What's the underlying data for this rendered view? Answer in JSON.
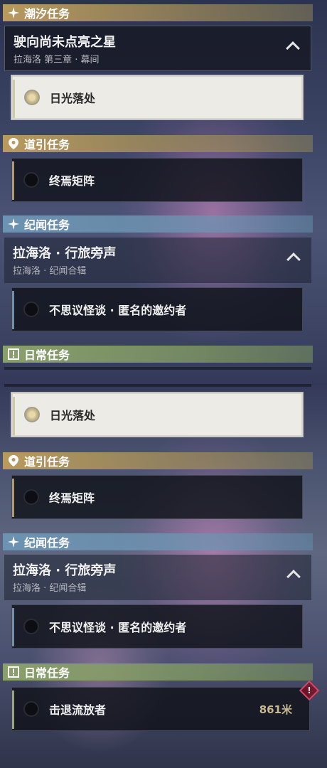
{
  "panels": [
    {
      "tide_header": "潮汐任务",
      "chapter_title": "驶向尚未点亮之星",
      "chapter_sub": "拉海洛 第三章 · 幕间",
      "tide_quest": "日光落处",
      "guide_header": "道引任务",
      "guide_quest": "终焉矩阵",
      "lore_header": "纪闻任务",
      "lore_title": "拉海洛 · 行旅旁声",
      "lore_sub": "拉海洛 · 纪闻合辑",
      "lore_quest": "不思议怪谈 · 匿名的邀约者",
      "daily_header": "日常任务"
    },
    {
      "tide_quest": "日光落处",
      "guide_header": "道引任务",
      "guide_quest": "终焉矩阵",
      "lore_header": "纪闻任务",
      "lore_title": "拉海洛 · 行旅旁声",
      "lore_sub": "拉海洛 · 纪闻合辑",
      "lore_quest": "不思议怪谈 · 匿名的邀约者",
      "daily_header": "日常任务",
      "daily_quest": "击退流放者",
      "daily_distance": "861米",
      "daily_alert": "!"
    }
  ],
  "icons": {
    "tide": "sparkle-icon",
    "guide": "location-pin-icon",
    "lore": "sparkle-icon",
    "daily": "exclamation-box-icon"
  },
  "colors": {
    "tide_gold": "#b89a5d",
    "lore_blue": "#6d93b2",
    "daily_green": "#8aa06b",
    "alert_red": "#d64864"
  }
}
